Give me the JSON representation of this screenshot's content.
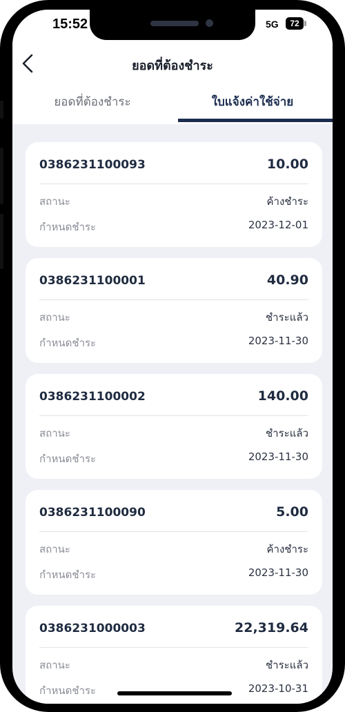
{
  "status_bar": {
    "time": "15:52",
    "network": "5G",
    "battery": "72"
  },
  "nav": {
    "back_icon": "chevron-left-icon",
    "title": "ยอดที่ต้องชำระ"
  },
  "tabs": [
    {
      "label": "ยอดที่ต้องชำระ",
      "active": false
    },
    {
      "label": "ใบแจ้งค่าใช้จ่าย",
      "active": true
    }
  ],
  "colors": {
    "accent": "#1b2d4f",
    "background": "#eef0f5",
    "card": "#ffffff"
  },
  "bills": [
    {
      "id": "0386231100093",
      "amount": "10.00",
      "status_label": "สถานะ",
      "status": "ค้างชำระ",
      "due_label": "กำหนดชำระ",
      "due": "2023-12-01"
    },
    {
      "id": "0386231100001",
      "amount": "40.90",
      "status_label": "สถานะ",
      "status": "ชำระแล้ว",
      "due_label": "กำหนดชำระ",
      "due": "2023-11-30"
    },
    {
      "id": "0386231100002",
      "amount": "140.00",
      "status_label": "สถานะ",
      "status": "ชำระแล้ว",
      "due_label": "กำหนดชำระ",
      "due": "2023-11-30"
    },
    {
      "id": "0386231100090",
      "amount": "5.00",
      "status_label": "สถานะ",
      "status": "ค้างชำระ",
      "due_label": "กำหนดชำระ",
      "due": "2023-11-30"
    },
    {
      "id": "0386231000003",
      "amount": "22,319.64",
      "status_label": "สถานะ",
      "status": "ชำระแล้ว",
      "due_label": "กำหนดชำระ",
      "due": "2023-10-31"
    }
  ]
}
